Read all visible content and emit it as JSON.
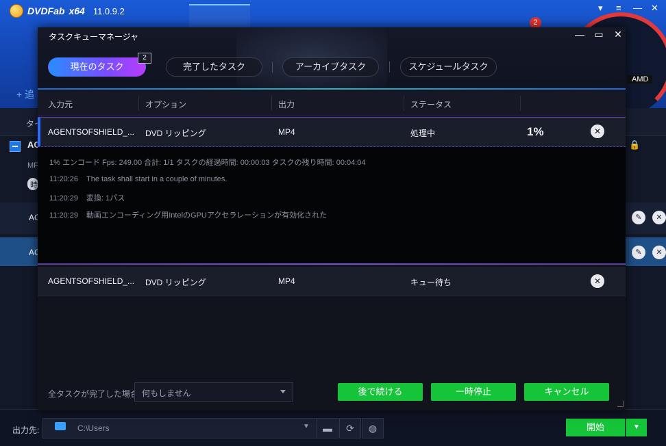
{
  "app": {
    "logo": "DVDFab",
    "arch": "x64",
    "version": "11.0.9.2",
    "notification_count": "2",
    "gauge_label": "AMD",
    "add_label": "+ 追",
    "row_title_fragment": "タイ",
    "selected_item_fragment": "AC",
    "meta_fragment": "MF",
    "pill_label": "時",
    "row2_fragment": "AC",
    "row3_fragment": "AC",
    "output": {
      "label": "出力先:",
      "path": "C:\\Users"
    },
    "start_label": "開始"
  },
  "modal": {
    "title": "タスクキューマネージャ",
    "tabs": [
      {
        "label": "現在のタスク",
        "count": "2"
      },
      {
        "label": "完了したタスク"
      },
      {
        "label": "アーカイブタスク"
      },
      {
        "label": "スケジュールタスク"
      }
    ],
    "columns": [
      "入力元",
      "オプション",
      "出力",
      "ステータス"
    ],
    "tasks": [
      {
        "source": "AGENTSOFSHIELD_...",
        "option": "DVD リッピング",
        "output": "MP4",
        "status": "処理中",
        "progress": "1%"
      },
      {
        "source": "AGENTSOFSHIELD_...",
        "option": "DVD リッピング",
        "output": "MP4",
        "status": "キュー待ち"
      }
    ],
    "log": {
      "summary": "1%  エンコード Fps: 249.00   合計: 1/1  タスクの経過時間: 00:00:03   タスクの残り時間: 00:04:04",
      "entries": [
        {
          "time": "11:20:26",
          "message": "The task shall start in a couple of minutes."
        },
        {
          "time": "11:20:29",
          "message": "変換: 1パス"
        },
        {
          "time": "11:20:29",
          "message": "動画エンコーディング用IntelのGPUアクセラレーションが有効化された"
        }
      ]
    },
    "footer": {
      "label": "全タスクが完了した場合:",
      "select_value": "何もしません",
      "buttons": [
        "後で続ける",
        "一時停止",
        "キャンセル"
      ]
    }
  }
}
